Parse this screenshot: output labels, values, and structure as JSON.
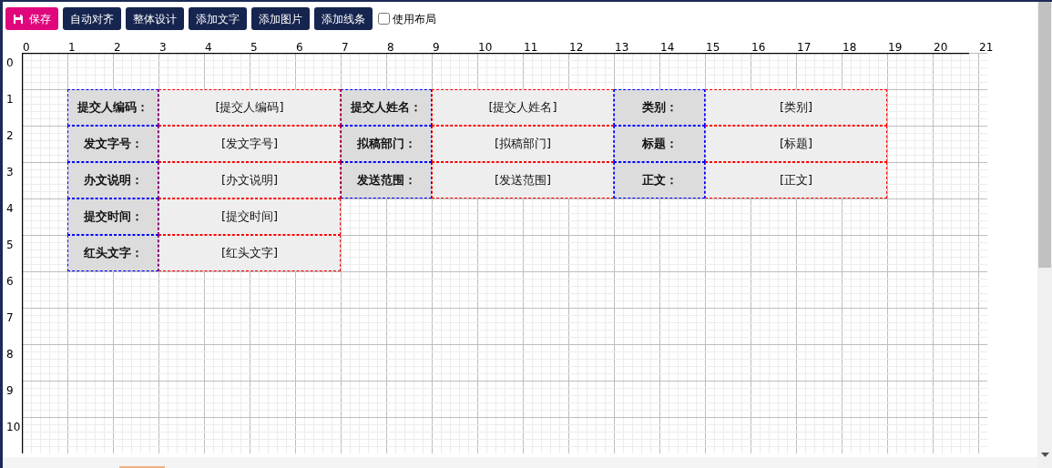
{
  "toolbar": {
    "buttons": [
      {
        "label": "保存",
        "kind": "primary"
      },
      {
        "label": "自动对齐",
        "kind": "default"
      },
      {
        "label": "整体设计",
        "kind": "default"
      },
      {
        "label": "添加文字",
        "kind": "default"
      },
      {
        "label": "添加图片",
        "kind": "default"
      },
      {
        "label": "添加线条",
        "kind": "default"
      }
    ],
    "checkbox": {
      "label": "使用布局",
      "checked": false
    }
  },
  "ruler": {
    "x_labels": [
      "0",
      "1",
      "2",
      "3",
      "4",
      "5",
      "6",
      "7",
      "8",
      "9",
      "10",
      "11",
      "12",
      "13",
      "14",
      "15",
      "16",
      "17",
      "18",
      "19",
      "20",
      "21"
    ],
    "y_labels": [
      "0",
      "1",
      "2",
      "3",
      "4",
      "5",
      "6",
      "7",
      "8",
      "9",
      "10"
    ]
  },
  "form": {
    "rows": [
      {
        "cells": [
          {
            "label": "提交人编码：",
            "value": "[提交人编码]"
          },
          {
            "label": "提交人姓名：",
            "value": "[提交人姓名]"
          },
          {
            "label": "类别：",
            "value": "[类别]"
          }
        ]
      },
      {
        "cells": [
          {
            "label": "发文字号：",
            "value": "[发文字号]"
          },
          {
            "label": "拟稿部门：",
            "value": "[拟稿部门]"
          },
          {
            "label": "标题：",
            "value": "[标题]"
          }
        ]
      },
      {
        "cells": [
          {
            "label": "办文说明：",
            "value": "[办文说明]"
          },
          {
            "label": "发送范围：",
            "value": "[发送范围]"
          },
          {
            "label": "正文：",
            "value": "[正文]"
          }
        ]
      },
      {
        "cells": [
          {
            "label": "提交时间：",
            "value": "[提交时间]"
          }
        ]
      },
      {
        "cells": [
          {
            "label": "红头文字：",
            "value": "[红头文字]"
          }
        ]
      }
    ]
  }
}
